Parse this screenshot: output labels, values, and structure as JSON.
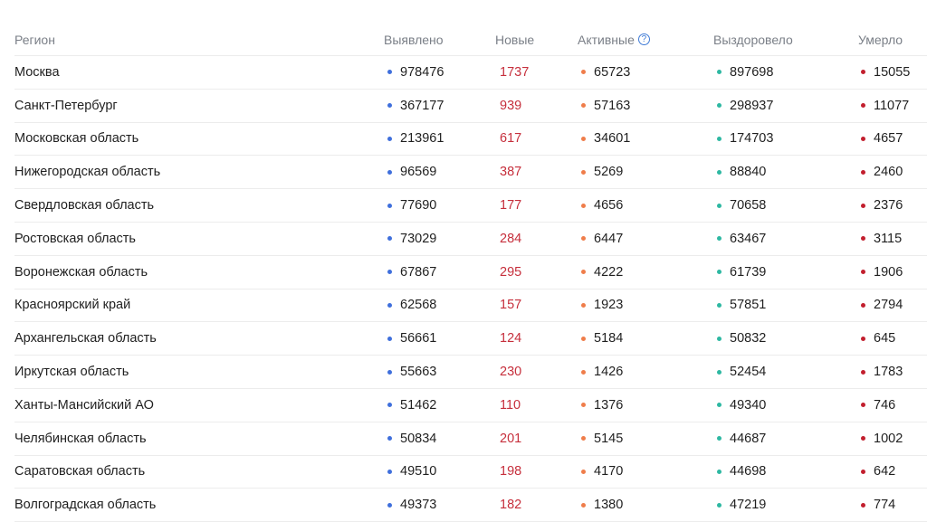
{
  "colors": {
    "found": "#3f6fdc",
    "new": "#c62f3c",
    "active": "#ef7d4a",
    "recovered": "#2eb8a2",
    "died": "#c21f2e"
  },
  "columns": {
    "region": "Регион",
    "found": "Выявлено",
    "new": "Новые",
    "active": "Активные",
    "recovered": "Выздоровело",
    "died": "Умерло"
  },
  "rows": [
    {
      "region": "Москва",
      "found": "978476",
      "new": "1737",
      "active": "65723",
      "recovered": "897698",
      "died": "15055"
    },
    {
      "region": "Санкт-Петербург",
      "found": "367177",
      "new": "939",
      "active": "57163",
      "recovered": "298937",
      "died": "11077"
    },
    {
      "region": "Московская область",
      "found": "213961",
      "new": "617",
      "active": "34601",
      "recovered": "174703",
      "died": "4657"
    },
    {
      "region": "Нижегородская область",
      "found": "96569",
      "new": "387",
      "active": "5269",
      "recovered": "88840",
      "died": "2460"
    },
    {
      "region": "Свердловская область",
      "found": "77690",
      "new": "177",
      "active": "4656",
      "recovered": "70658",
      "died": "2376"
    },
    {
      "region": "Ростовская область",
      "found": "73029",
      "new": "284",
      "active": "6447",
      "recovered": "63467",
      "died": "3115"
    },
    {
      "region": "Воронежская область",
      "found": "67867",
      "new": "295",
      "active": "4222",
      "recovered": "61739",
      "died": "1906"
    },
    {
      "region": "Красноярский край",
      "found": "62568",
      "new": "157",
      "active": "1923",
      "recovered": "57851",
      "died": "2794"
    },
    {
      "region": "Архангельская область",
      "found": "56661",
      "new": "124",
      "active": "5184",
      "recovered": "50832",
      "died": "645"
    },
    {
      "region": "Иркутская область",
      "found": "55663",
      "new": "230",
      "active": "1426",
      "recovered": "52454",
      "died": "1783"
    },
    {
      "region": "Ханты-Мансийский АО",
      "found": "51462",
      "new": "110",
      "active": "1376",
      "recovered": "49340",
      "died": "746"
    },
    {
      "region": "Челябинская область",
      "found": "50834",
      "new": "201",
      "active": "5145",
      "recovered": "44687",
      "died": "1002"
    },
    {
      "region": "Саратовская область",
      "found": "49510",
      "new": "198",
      "active": "4170",
      "recovered": "44698",
      "died": "642"
    },
    {
      "region": "Волгоградская область",
      "found": "49373",
      "new": "182",
      "active": "1380",
      "recovered": "47219",
      "died": "774"
    }
  ]
}
